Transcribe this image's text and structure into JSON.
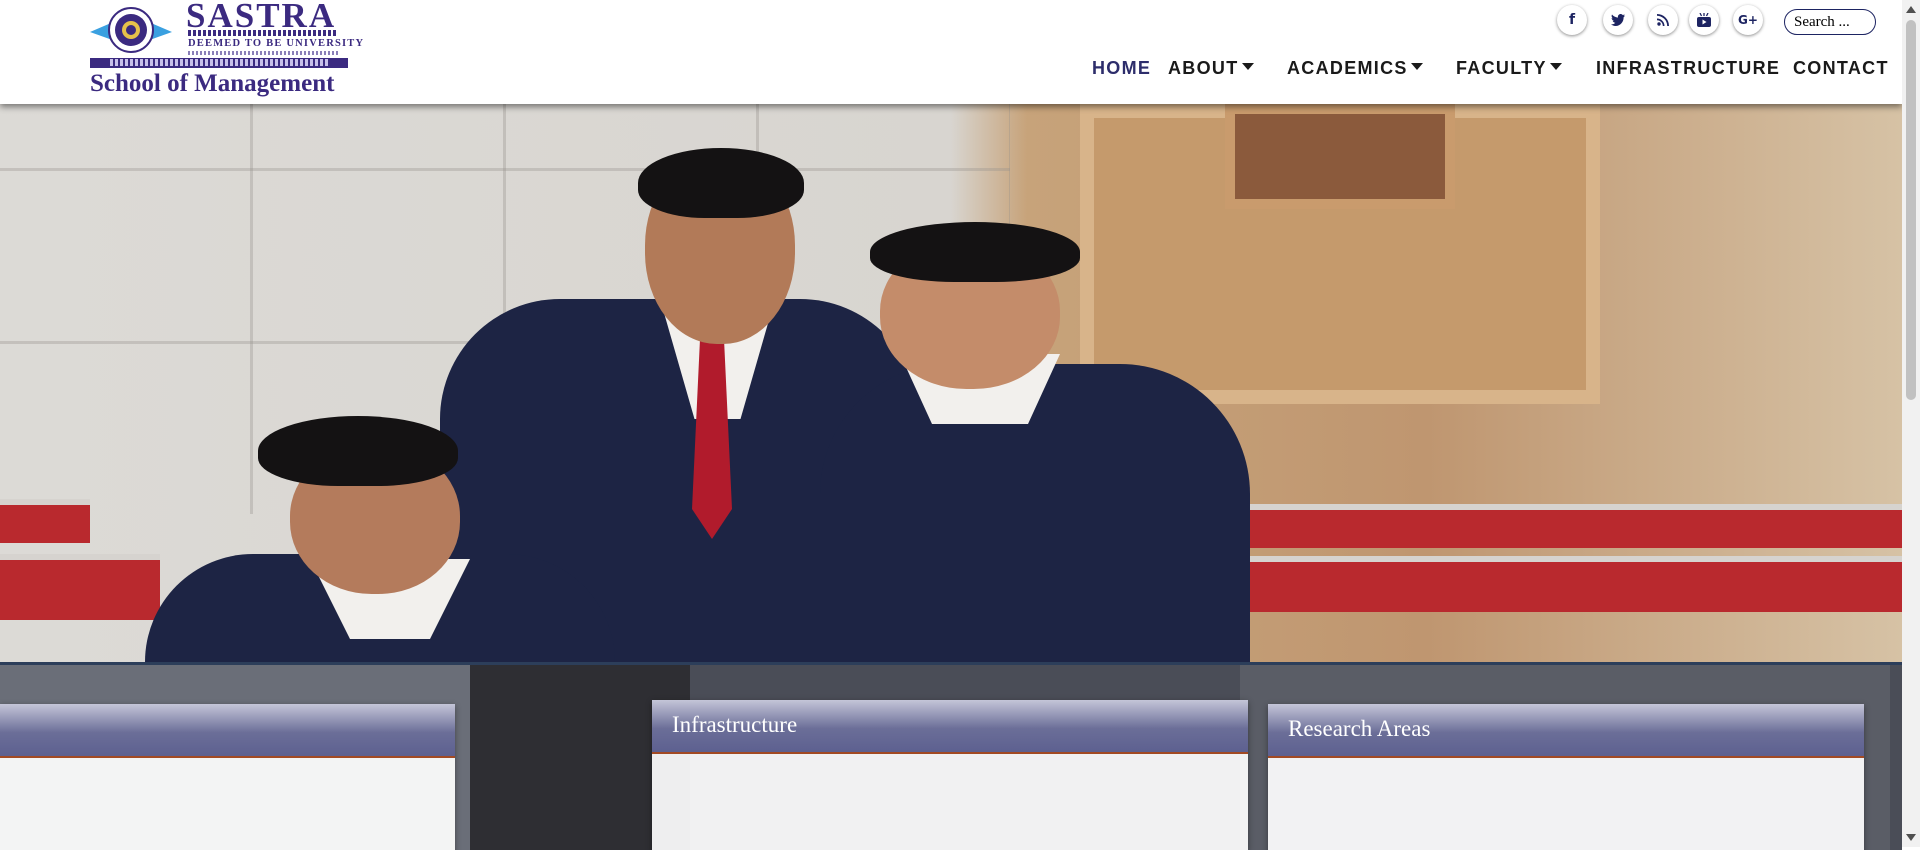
{
  "header": {
    "logo": {
      "name": "SASTRA",
      "subtitle": "DEEMED TO BE UNIVERSITY",
      "school": "School of Management"
    },
    "social": [
      {
        "icon": "facebook-icon",
        "glyph": "f"
      },
      {
        "icon": "twitter-icon",
        "glyph": "t"
      },
      {
        "icon": "rss-icon",
        "glyph": "◔"
      },
      {
        "icon": "youtube-icon",
        "glyph": "▣"
      },
      {
        "icon": "google-plus-icon",
        "glyph": "G+"
      }
    ],
    "search": {
      "placeholder": "Search ..."
    },
    "nav": {
      "home": "HOME",
      "about": "ABOUT",
      "academics": "ACADEMICS",
      "faculty": "FACULTY",
      "infrastructure": "INFRASTRUCTURE",
      "contact": "CONTACT"
    }
  },
  "cards": {
    "left": {
      "title": ""
    },
    "middle": {
      "title": "Infrastructure"
    },
    "right": {
      "title": "Research Areas"
    }
  },
  "colors": {
    "brand": "#3b2a80",
    "nav_active": "#2d2d6b",
    "card_header": "#5d6090",
    "card_accent": "#a24a24"
  }
}
